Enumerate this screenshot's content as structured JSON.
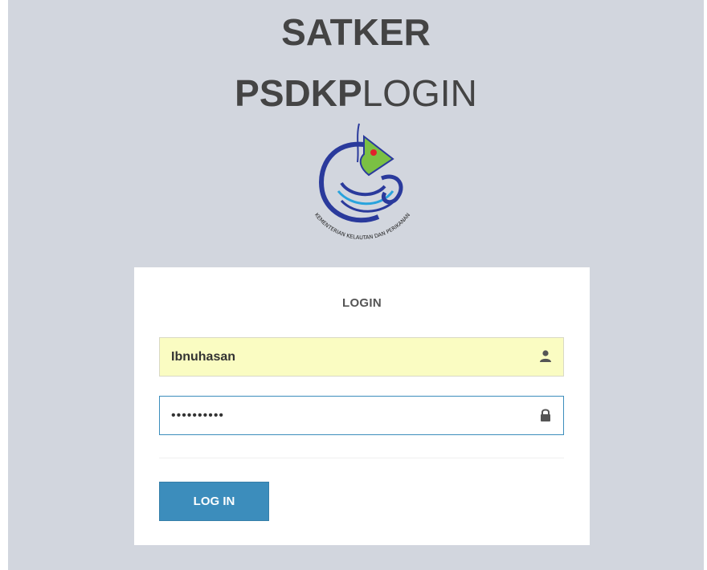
{
  "header": {
    "line1": "SATKER",
    "line2_bold": "PSDKP",
    "line2_light": "LOGIN"
  },
  "logo": {
    "icon": "kkp-emblem-icon",
    "caption": "KEMENTERIAN KELAUTAN DAN PERIKANAN"
  },
  "login_box": {
    "title": "LOGIN",
    "username_value": "Ibnuhasan",
    "username_icon": "user-icon",
    "password_value": "••••••••••",
    "password_icon": "lock-icon",
    "submit_label": "LOG IN"
  },
  "colors": {
    "background": "#d2d6de",
    "primary": "#3c8dbc",
    "autofill": "#fafcc2"
  }
}
